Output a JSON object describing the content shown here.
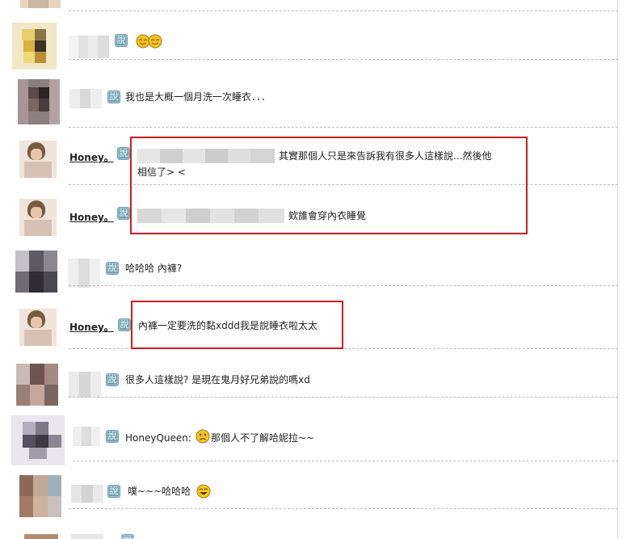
{
  "badge_label": "說",
  "colors": {
    "highlight": "#cf1f1f",
    "badge": "#6a9fb0",
    "divider": "#bcbcbc"
  },
  "comments": [
    {
      "id": "c0",
      "user": "",
      "message": "",
      "emoji": "smile-icon"
    },
    {
      "id": "c1",
      "user": "",
      "message": "",
      "emoji": "grin-pair-icon"
    },
    {
      "id": "c2",
      "user": "",
      "message": "我也是大概一個月洗一次睡衣．．．"
    },
    {
      "id": "c3",
      "user": "Honey。",
      "message_lines": [
        "其實那個人只是來告訴我有很多人這樣說...然後他",
        "相信了> <"
      ]
    },
    {
      "id": "c4",
      "user": "Honey。",
      "message": "欸誰會穿內衣睡覺"
    },
    {
      "id": "c5",
      "user": "",
      "message": "哈哈哈 內褲?"
    },
    {
      "id": "c6",
      "user": "Honey。",
      "message": "內褲一定要洗的黏xddd我是說睡衣啦太太"
    },
    {
      "id": "c7",
      "user": "",
      "message": "很多人這樣說? 是現在鬼月好兄弟說的嗎xd"
    },
    {
      "id": "c8",
      "user": "",
      "message_prefix": "HoneyQueen:",
      "message": "那個人不了解哈妮拉~~",
      "emoji": "sad-face-icon"
    },
    {
      "id": "c9",
      "user": "",
      "message": "噗~~~哈哈哈",
      "emoji": "laugh-icon"
    },
    {
      "id": "c10",
      "user": "",
      "message": ""
    }
  ]
}
